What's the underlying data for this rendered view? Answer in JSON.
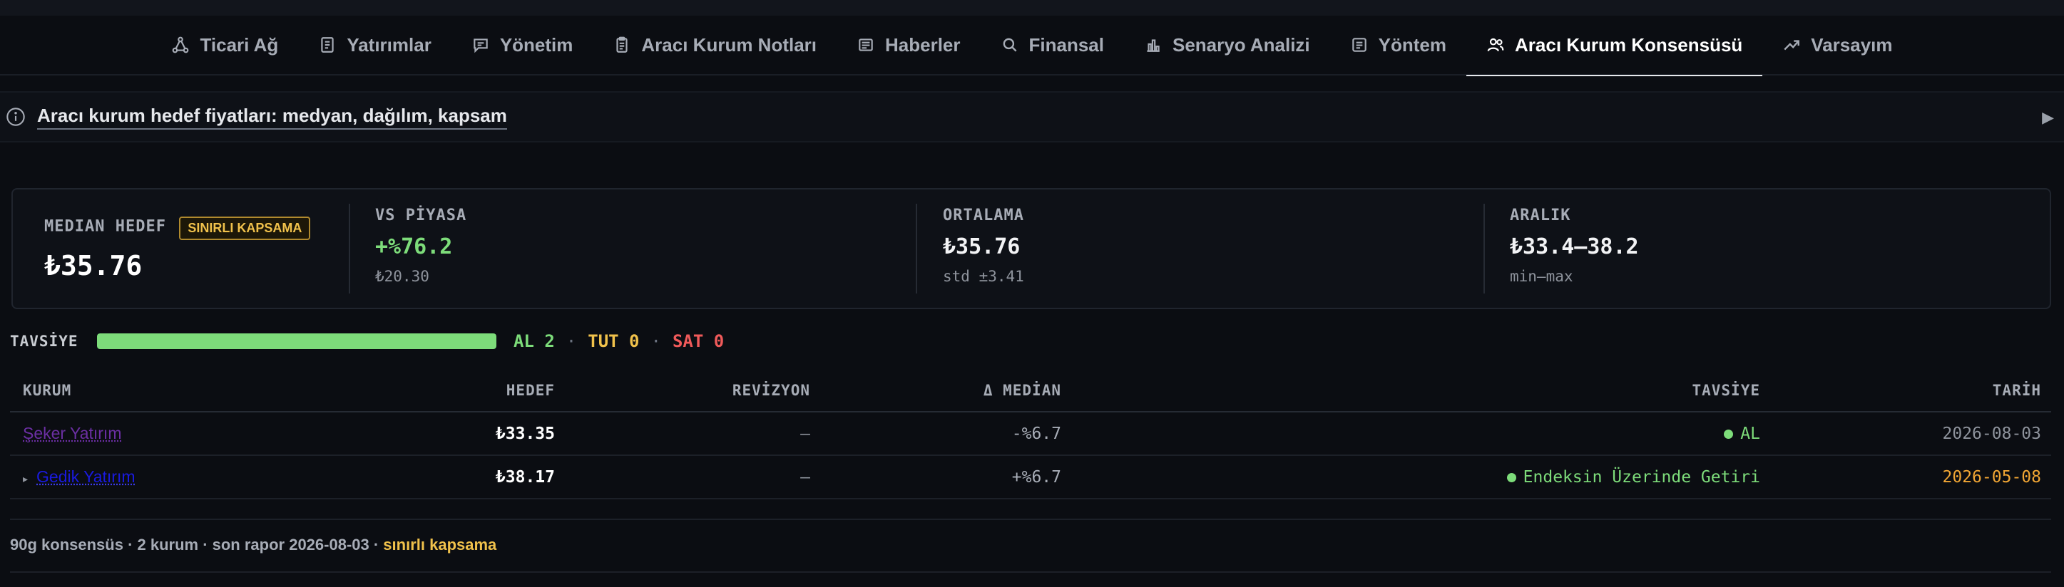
{
  "tabs": [
    {
      "label": "Ticari Ağ",
      "icon": "network-icon",
      "active": false
    },
    {
      "label": "Yatırımlar",
      "icon": "ledger-icon",
      "active": false
    },
    {
      "label": "Yönetim",
      "icon": "message-icon",
      "active": false
    },
    {
      "label": "Aracı Kurum Notları",
      "icon": "clipboard-icon",
      "active": false
    },
    {
      "label": "Haberler",
      "icon": "newspaper-icon",
      "active": false
    },
    {
      "label": "Finansal",
      "icon": "search-icon",
      "active": false
    },
    {
      "label": "Senaryo Analizi",
      "icon": "bar-chart-icon",
      "active": false
    },
    {
      "label": "Yöntem",
      "icon": "document-icon",
      "active": false
    },
    {
      "label": "Aracı Kurum Konsensüsü",
      "icon": "users-icon",
      "active": true
    },
    {
      "label": "Varsayım",
      "icon": "trend-up-icon",
      "active": false
    }
  ],
  "info": {
    "title": "Aracı kurum hedef fiyatları: medyan, dağılım, kapsam"
  },
  "summary": {
    "median": {
      "label": "MEDIAN HEDEF",
      "badge": "SINIRLI KAPSAMA",
      "value": "₺35.76"
    },
    "vs_market": {
      "label": "VS PİYASA",
      "value": "+%76.2",
      "sub": "₺20.30"
    },
    "average": {
      "label": "ORTALAMA",
      "value": "₺35.76",
      "sub": "std ±3.41"
    },
    "range": {
      "label": "ARALIK",
      "value": "₺33.4–38.2",
      "sub": "min–max"
    }
  },
  "recommendation": {
    "label": "TAVSİYE",
    "buy_share": 1.0,
    "buy": "AL 2",
    "hold": "TUT 0",
    "sell": "SAT 0",
    "separator": "·"
  },
  "table": {
    "headers": {
      "firm": "KURUM",
      "target": "HEDEF",
      "revision": "REVİZYON",
      "delta": "Δ MEDİAN",
      "rec": "TAVSİYE",
      "date": "TARİH"
    },
    "rows": [
      {
        "firm": "Şeker Yatırım",
        "target": "₺33.35",
        "revision": "—",
        "delta": "-%6.7",
        "rec": "AL",
        "date": "2026-08-03"
      },
      {
        "firm": "Gedik Yatırım",
        "target": "₺38.17",
        "revision": "—",
        "delta": "+%6.7",
        "rec": "Endeksin Üzerinde Getiri",
        "date": "2026-05-08"
      }
    ]
  },
  "footer": {
    "text": "90g konsensüs · 2 kurum · son rapor 2026-08-03 · ",
    "warning": "sınırlı kapsama"
  },
  "colors": {
    "accent_green": "#7ddc7a",
    "warn_yellow": "#f0c14b",
    "sell_red": "#f05a5a",
    "date_amber": "#f0a534"
  }
}
